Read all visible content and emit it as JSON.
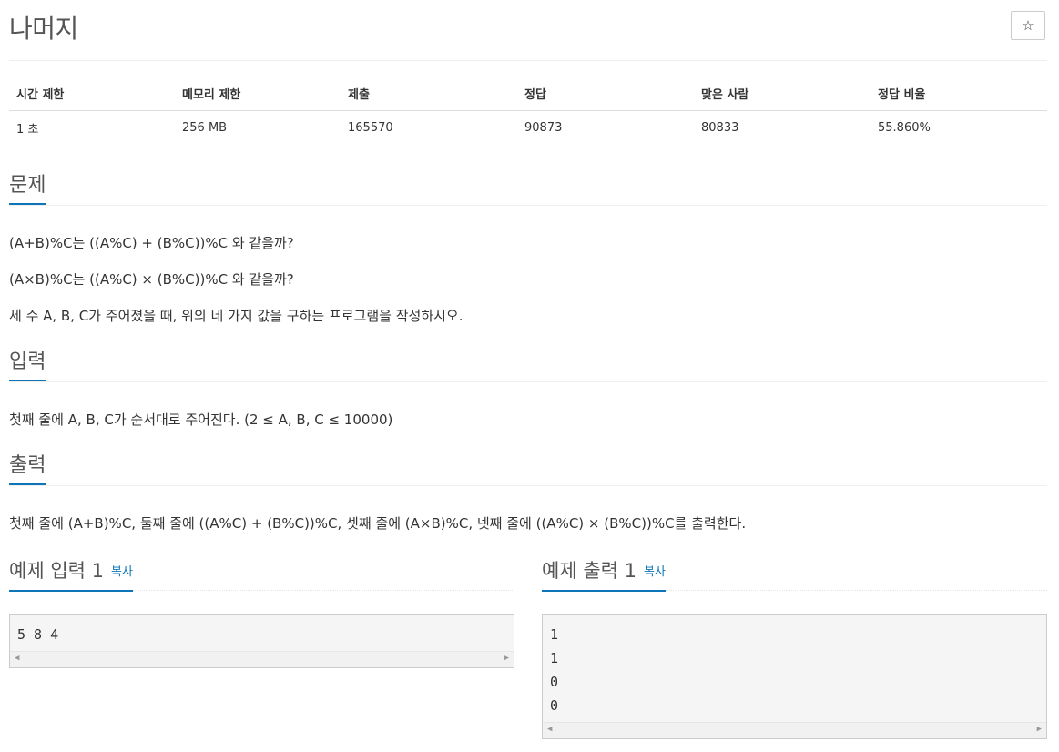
{
  "problem": {
    "title": "나머지",
    "star_icon": "☆"
  },
  "info_table": {
    "headers": [
      "시간 제한",
      "메모리 제한",
      "제출",
      "정답",
      "맞은 사람",
      "정답 비율"
    ],
    "values": [
      "1 초",
      "256 MB",
      "165570",
      "90873",
      "80833",
      "55.860%"
    ]
  },
  "sections": {
    "problem": {
      "heading": "문제",
      "lines": [
        "(A+B)%C는 ((A%C) + (B%C))%C 와 같을까?",
        "(A×B)%C는 ((A%C) × (B%C))%C 와 같을까?",
        "세 수 A, B, C가 주어졌을 때, 위의 네 가지 값을 구하는 프로그램을 작성하시오."
      ]
    },
    "input": {
      "heading": "입력",
      "text": "첫째 줄에 A, B, C가 순서대로 주어진다. (2 ≤ A, B, C ≤ 10000)"
    },
    "output": {
      "heading": "출력",
      "text": "첫째 줄에 (A+B)%C, 둘째 줄에 ((A%C) + (B%C))%C, 셋째 줄에 (A×B)%C, 넷째 줄에 ((A%C) × (B%C))%C를 출력한다."
    }
  },
  "samples": {
    "input": {
      "heading": "예제 입력 1",
      "copy_label": "복사",
      "lines": [
        "5 8 4"
      ]
    },
    "output": {
      "heading": "예제 출력 1",
      "copy_label": "복사",
      "lines": [
        "1",
        "1",
        "0",
        "0"
      ]
    }
  },
  "colors": {
    "accent": "#0e76b8"
  }
}
